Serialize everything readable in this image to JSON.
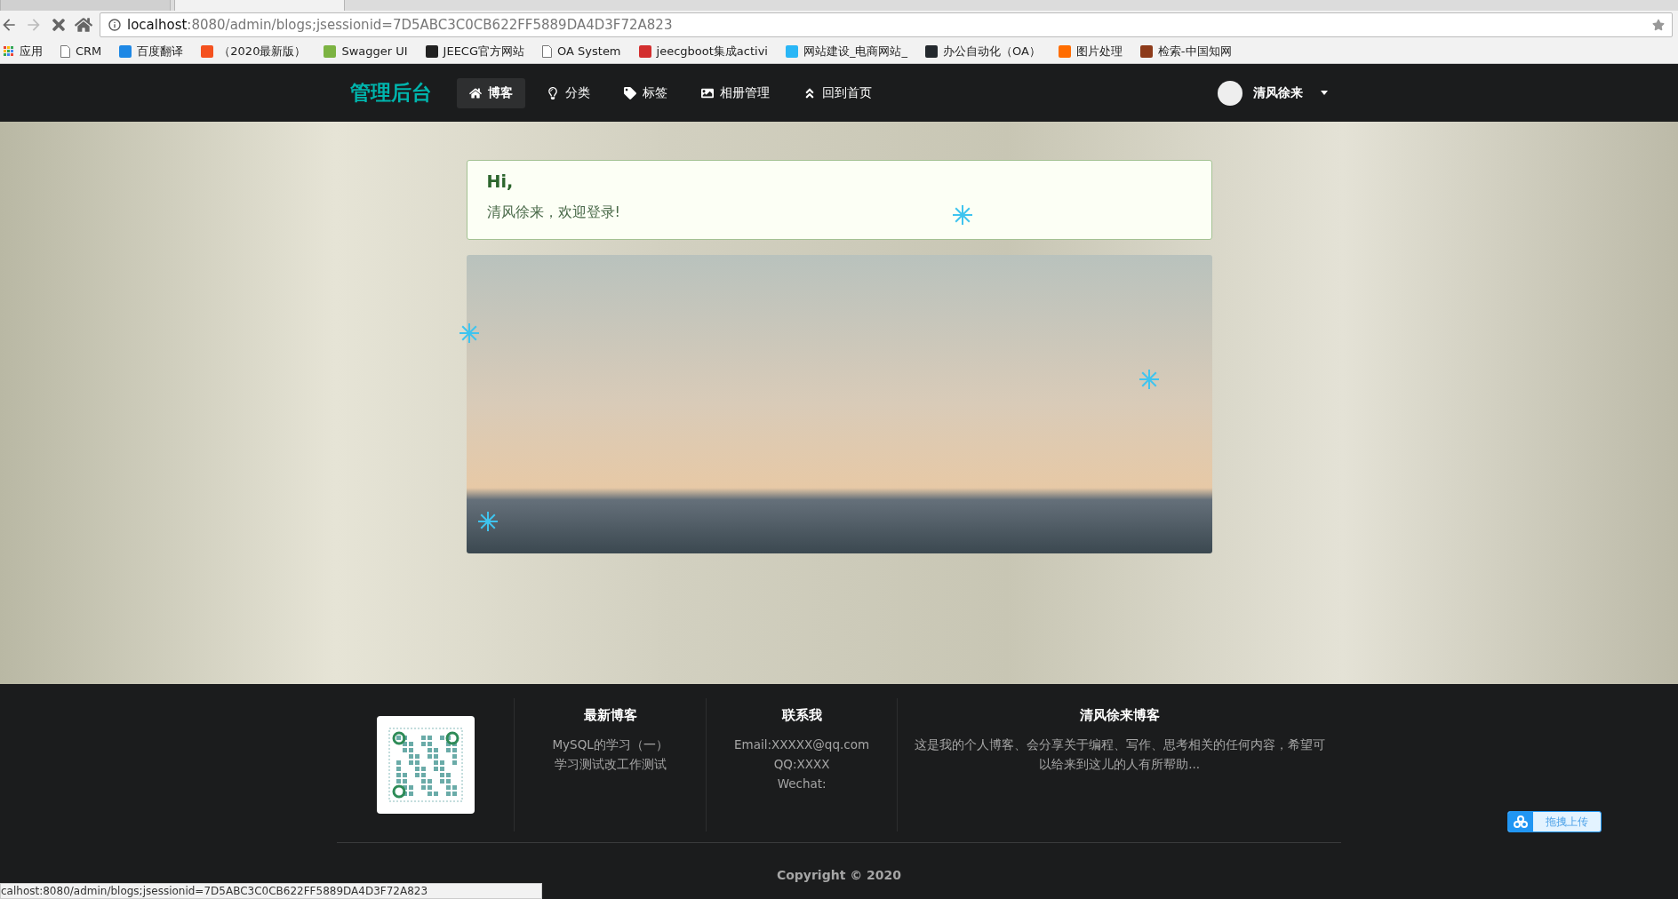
{
  "browser": {
    "tabs": [
      {
        "selected": false
      },
      {
        "selected": true
      }
    ],
    "url_host": "localhost",
    "url_rest": ":8080/admin/blogs;jsessionid=7D5ABC3C0CB622FF5889DA4D3F72A823",
    "bookmarks": [
      {
        "kind": "apps",
        "label": "应用"
      },
      {
        "kind": "page",
        "label": "CRM"
      },
      {
        "kind": "logo",
        "color": "#1e88e5",
        "label": "百度翻译"
      },
      {
        "kind": "logo",
        "color": "#f4511e",
        "label": "（2020最新版）"
      },
      {
        "kind": "logo",
        "color": "#7cb342",
        "label": "Swagger UI"
      },
      {
        "kind": "logo",
        "color": "#212121",
        "label": "JEECG官方网站"
      },
      {
        "kind": "page",
        "label": "OA System"
      },
      {
        "kind": "logo",
        "color": "#d32f2f",
        "label": "jeecgboot集成activi"
      },
      {
        "kind": "logo",
        "color": "#29b6f6",
        "label": "网站建设_电商网站_"
      },
      {
        "kind": "logo",
        "color": "#24292e",
        "label": "办公自动化（OA）"
      },
      {
        "kind": "logo",
        "color": "#ff6d00",
        "label": "图片处理"
      },
      {
        "kind": "logo",
        "color": "#8d3b1a",
        "label": "检索-中国知网"
      }
    ],
    "status_url": "calhost:8080/admin/blogs;jsessionid=7D5ABC3C0CB622FF5889DA4D3F72A823"
  },
  "nav": {
    "brand": "管理后台",
    "items": [
      {
        "kind": "home",
        "label": "博客",
        "selected": true
      },
      {
        "kind": "bulb",
        "label": "分类",
        "selected": false
      },
      {
        "kind": "tag",
        "label": "标签",
        "selected": false
      },
      {
        "kind": "image",
        "label": "相册管理",
        "selected": false
      },
      {
        "kind": "up",
        "label": "回到首页",
        "selected": false
      }
    ],
    "user": "清风徐来"
  },
  "welcome": {
    "greeting": "Hi,",
    "message": "清风徐来，欢迎登录!"
  },
  "footer": {
    "columns": [
      {
        "title": "最新博客",
        "lines": [
          "MySQL的学习（一）",
          "学习测试改工作测试"
        ]
      },
      {
        "title": "联系我",
        "lines": [
          "Email:XXXXX@qq.com",
          "QQ:XXXX",
          "Wechat:"
        ]
      },
      {
        "title": "清风徐来博客",
        "lines": [
          "这是我的个人博客、会分享关于编程、写作、思考相关的任何内容，希望可以给来到这儿的人有所帮助..."
        ]
      }
    ],
    "copyright": "Copyright © 2020"
  },
  "upload_button": "拖拽上传"
}
